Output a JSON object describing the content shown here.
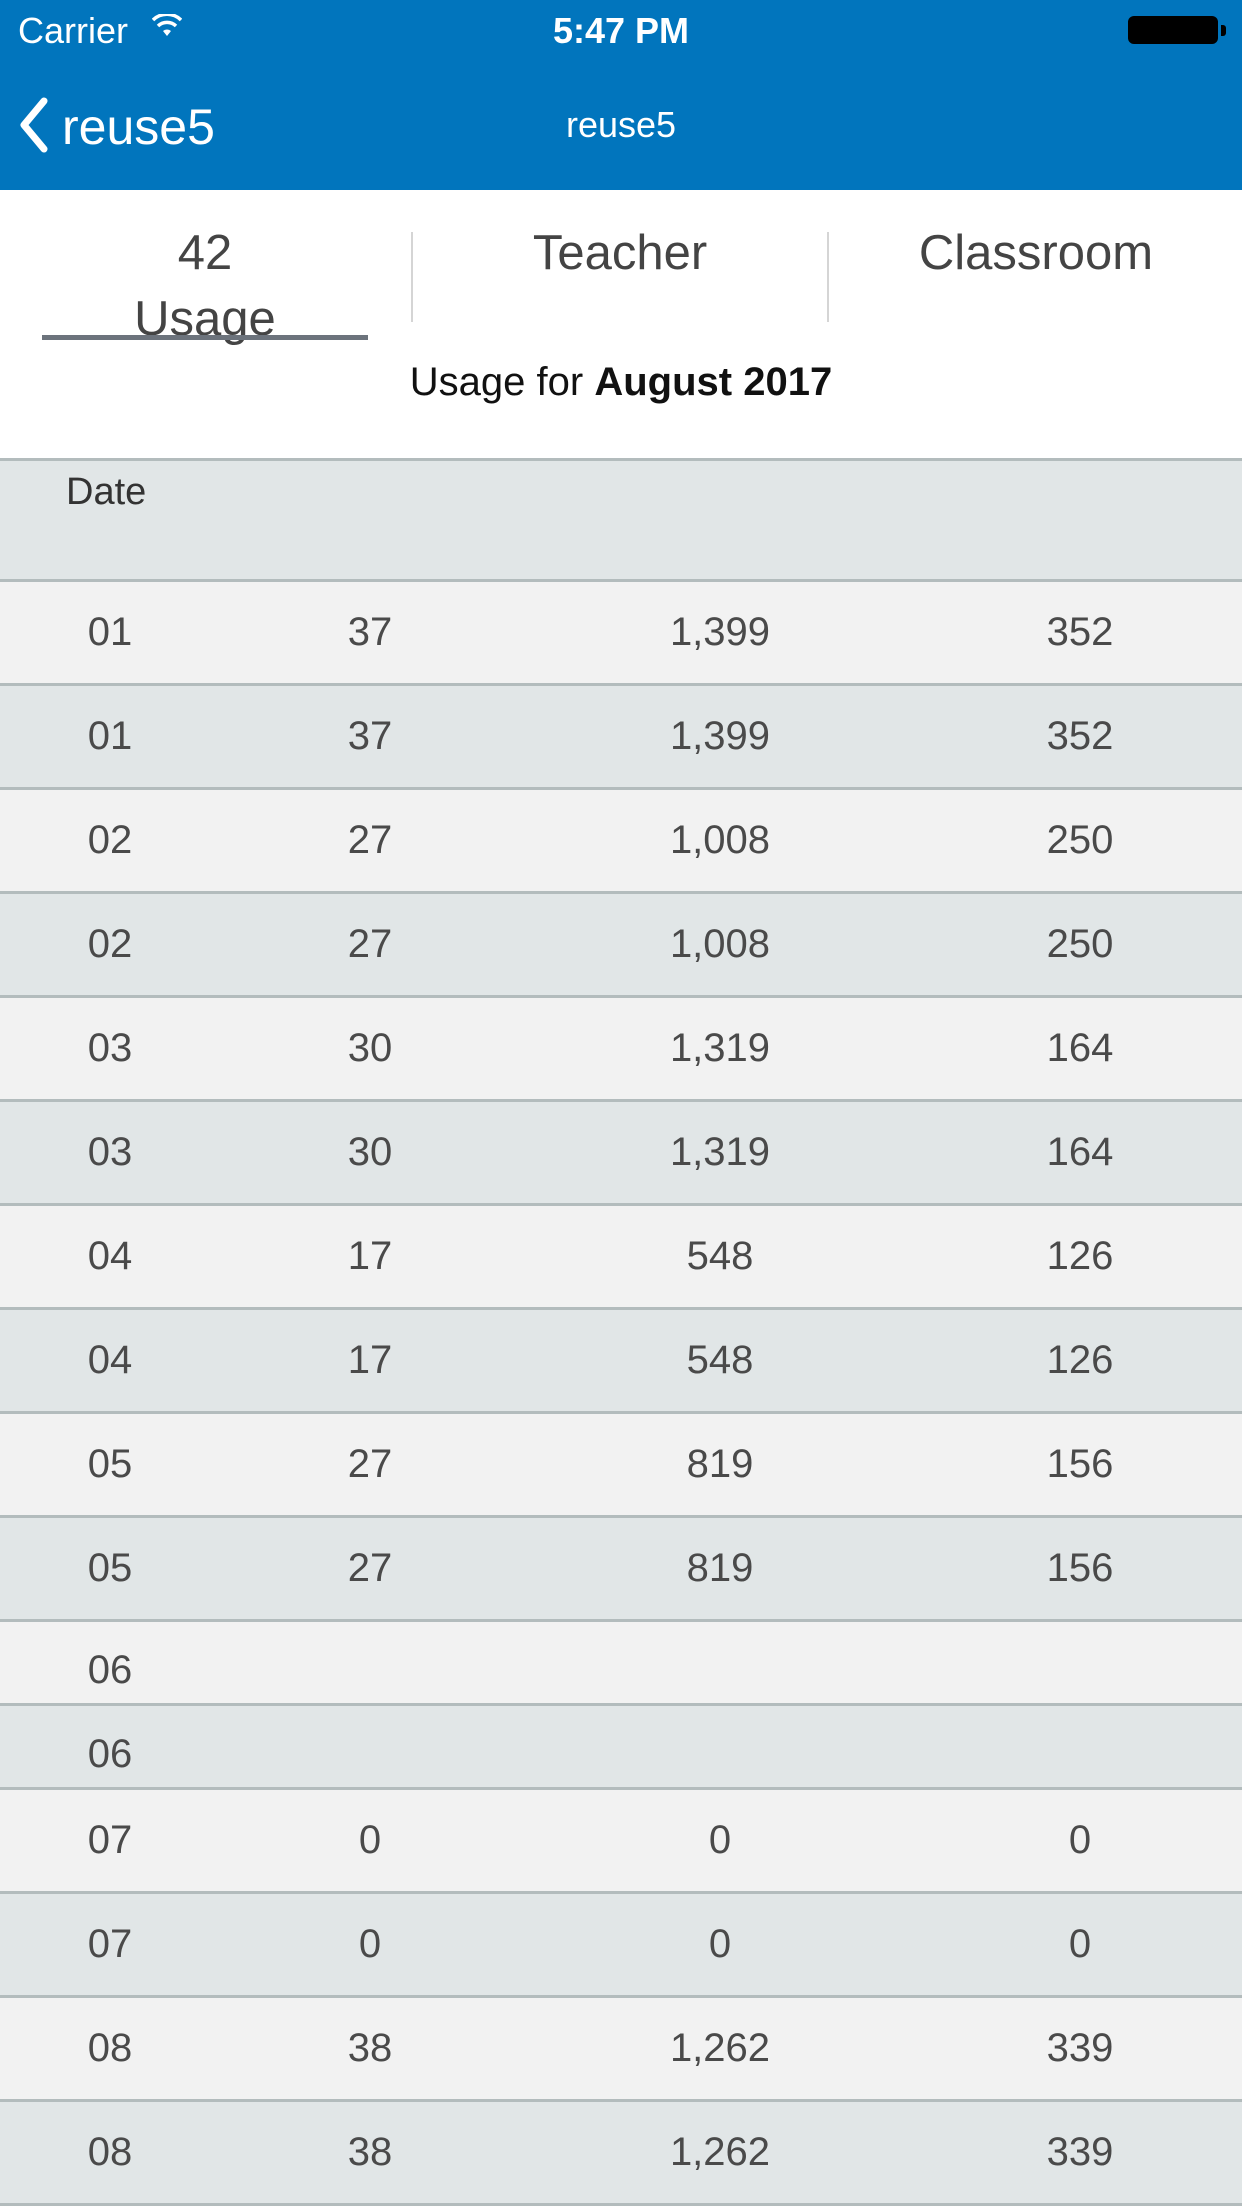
{
  "status_bar": {
    "carrier": "Carrier",
    "time": "5:47 PM"
  },
  "nav": {
    "back_label": "reuse5",
    "title": "reuse5"
  },
  "tabs": [
    {
      "count": "42",
      "label": "Usage",
      "selected": true
    },
    {
      "label": "Teacher",
      "selected": false
    },
    {
      "label": "Classroom",
      "selected": false
    }
  ],
  "subtitle": {
    "prefix": "Usage for",
    "period": "August 2017"
  },
  "table": {
    "header": {
      "date": "Date"
    },
    "rows": [
      [
        "01",
        "37",
        "1,399",
        "352"
      ],
      [
        "01",
        "37",
        "1,399",
        "352"
      ],
      [
        "02",
        "27",
        "1,008",
        "250"
      ],
      [
        "02",
        "27",
        "1,008",
        "250"
      ],
      [
        "03",
        "30",
        "1,319",
        "164"
      ],
      [
        "03",
        "30",
        "1,319",
        "164"
      ],
      [
        "04",
        "17",
        "548",
        "126"
      ],
      [
        "04",
        "17",
        "548",
        "126"
      ],
      [
        "05",
        "27",
        "819",
        "156"
      ],
      [
        "05",
        "27",
        "819",
        "156"
      ],
      [
        "06",
        "",
        "",
        ""
      ],
      [
        "06",
        "",
        "",
        ""
      ],
      [
        "07",
        "0",
        "0",
        "0"
      ],
      [
        "07",
        "0",
        "0",
        "0"
      ],
      [
        "08",
        "38",
        "1,262",
        "339"
      ],
      [
        "08",
        "38",
        "1,262",
        "339"
      ]
    ]
  },
  "colors": {
    "nav_bar": "#0175bd",
    "row_light": "#f2f2f2",
    "row_dark": "#e1e6e7"
  },
  "icons": {
    "back": "chevron-left-icon",
    "wifi": "wifi-icon",
    "battery": "battery-icon"
  }
}
